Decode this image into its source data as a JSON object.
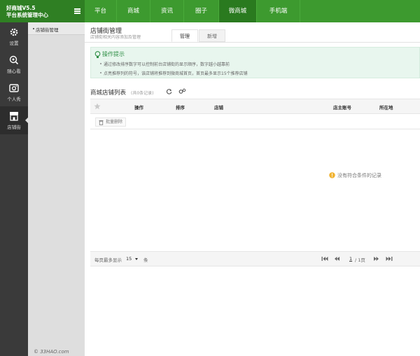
{
  "brand": {
    "name": "好商城V5.5",
    "subtitle": "平台系统管理中心"
  },
  "nav": [
    {
      "label": "平台",
      "active": false
    },
    {
      "label": "商城",
      "active": false
    },
    {
      "label": "资讯",
      "active": false
    },
    {
      "label": "圈子",
      "active": false
    },
    {
      "label": "微商城",
      "active": true
    },
    {
      "label": "手机端",
      "active": false
    }
  ],
  "sidebar_icons": [
    {
      "label": "设置",
      "icon": "gear-icon"
    },
    {
      "label": "随心看",
      "icon": "eye-icon"
    },
    {
      "label": "个人秀",
      "icon": "camera-icon"
    },
    {
      "label": "店铺街",
      "icon": "store-icon",
      "active": true
    }
  ],
  "submenu": {
    "item": "店铺街管理"
  },
  "footer": {
    "copyright": "© 33HAO.com"
  },
  "page": {
    "title": "店铺街管理",
    "subtitle": "店铺街相关内容添加及管理"
  },
  "tabs": [
    {
      "label": "管理",
      "active": true
    },
    {
      "label": "新增",
      "active": false
    }
  ],
  "tips": {
    "title": "操作提示",
    "lines": [
      "通过修改排序数字可以控制前台店铺街的显示顺序，数字越小越靠前",
      "点亮推荐列的符号，该店铺将推荐到微商城首页，首页最多显示15个推荐店铺"
    ]
  },
  "list": {
    "title": "商城店铺列表",
    "count": "(共0条记录)",
    "columns": [
      "操作",
      "排序",
      "店铺",
      "店主账号",
      "所在地"
    ],
    "bulk_delete": "批量删除",
    "empty": "没有符合条件的记录"
  },
  "pagination": {
    "per_page_label": "每页最多显示",
    "per_page": "15",
    "unit": "条",
    "current": "1",
    "total": "/ 1页"
  }
}
